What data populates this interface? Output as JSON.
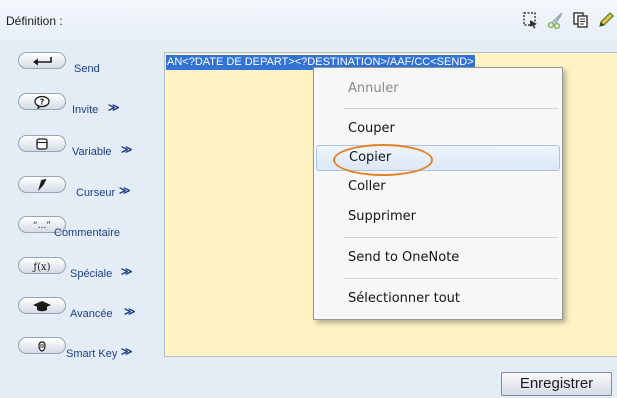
{
  "header": {
    "title": "Définition :"
  },
  "palette": {
    "items": [
      {
        "label": "Send",
        "chevron": ""
      },
      {
        "label": "Invite",
        "chevron": "≫"
      },
      {
        "label": "Variable",
        "chevron": "≫"
      },
      {
        "label": "Curseur",
        "chevron": "≫"
      },
      {
        "label": "Commentaire",
        "chevron": ""
      },
      {
        "label": "Spéciale",
        "chevron": "≫"
      },
      {
        "label": "Avancée",
        "chevron": "≫"
      },
      {
        "label": "Smart Key",
        "chevron": "≫"
      }
    ]
  },
  "editor": {
    "selected_text": "AN<?DATE DE DEPART><?DESTINATION>/AAF/CC<SEND>"
  },
  "context_menu": {
    "undo": "Annuler",
    "cut": "Couper",
    "copy": "Copier",
    "paste": "Coller",
    "delete": "Supprimer",
    "send_to_onenote": "Send to OneNote",
    "select_all": "Sélectionner tout"
  },
  "footer": {
    "save_label": "Enregistrer"
  },
  "colors": {
    "editor_background": "#fdf3c3",
    "selection": "#3373d6",
    "highlight_circle": "#e2832c",
    "palette_label": "#1d3f86"
  }
}
